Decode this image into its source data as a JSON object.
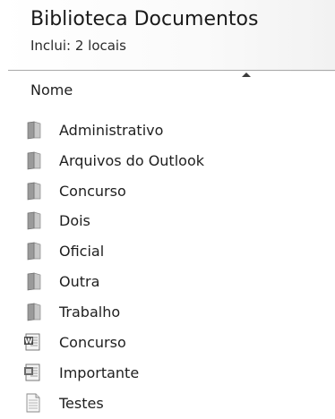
{
  "library": {
    "title": "Biblioteca Documentos",
    "subtitle": "Inclui: 2 locais"
  },
  "columns": {
    "name_label": "Nome",
    "sort_direction": "ascending"
  },
  "items": [
    {
      "name": "Administrativo",
      "icon": "folder-icon"
    },
    {
      "name": "Arquivos do Outlook",
      "icon": "folder-icon"
    },
    {
      "name": "Concurso",
      "icon": "folder-icon"
    },
    {
      "name": "Dois",
      "icon": "folder-icon"
    },
    {
      "name": "Oficial",
      "icon": "folder-icon"
    },
    {
      "name": "Outra",
      "icon": "folder-icon"
    },
    {
      "name": "Trabalho",
      "icon": "folder-icon"
    },
    {
      "name": "Concurso",
      "icon": "word-document-icon"
    },
    {
      "name": "Importante",
      "icon": "document-icon"
    },
    {
      "name": "Testes",
      "icon": "text-file-icon"
    }
  ]
}
